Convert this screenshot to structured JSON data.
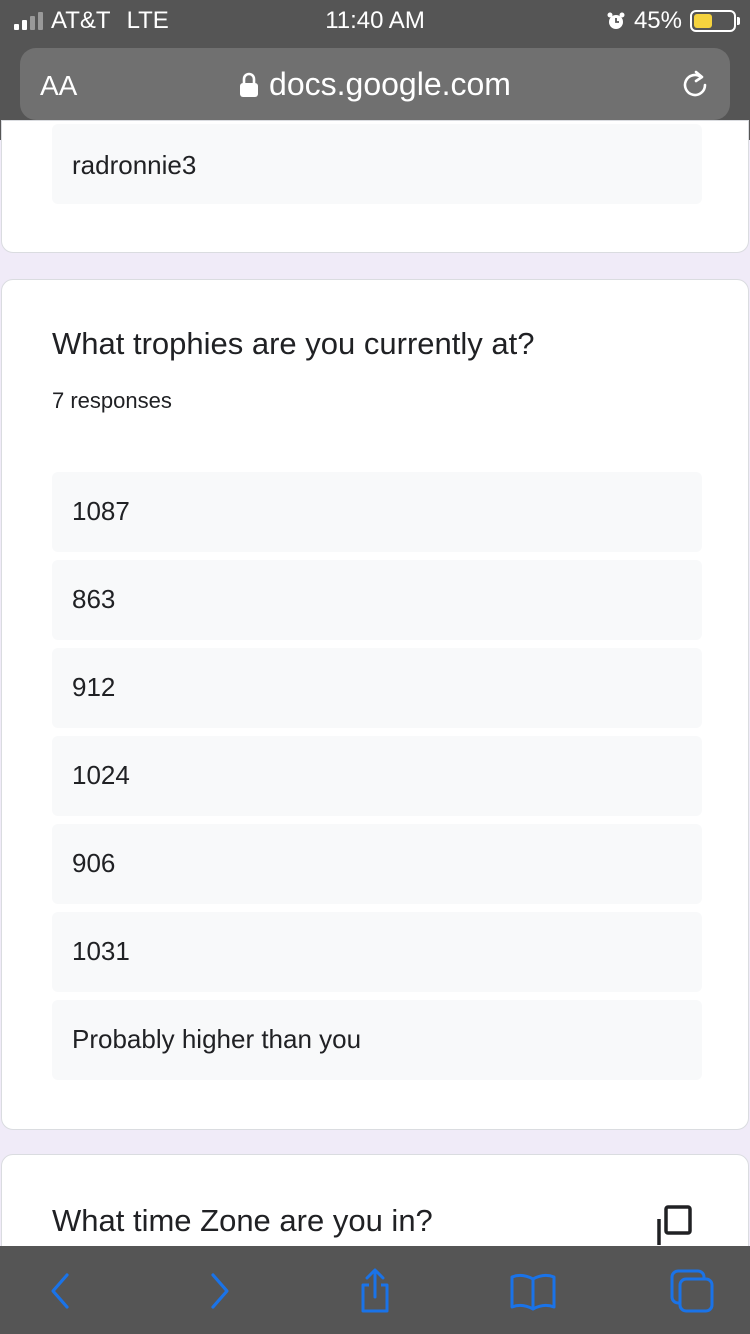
{
  "status_bar": {
    "carrier": "AT&T",
    "network": "LTE",
    "time": "11:40 AM",
    "battery": "45%",
    "battery_level": 0.45,
    "icons": [
      "signal-icon",
      "alarm-icon",
      "battery-icon"
    ]
  },
  "address_bar": {
    "text_size_label": "AA",
    "url": "docs.google.com",
    "icons": [
      "lock-icon",
      "reload-icon"
    ]
  },
  "previous_card": {
    "answer": "radronnie3"
  },
  "question": {
    "title": "What trophies are you currently at?",
    "responses_label": "7 responses",
    "answers": [
      "1087",
      "863",
      "912",
      "1024",
      "906",
      "1031",
      "Probably higher than you"
    ]
  },
  "next_question": {
    "title": "What time Zone are you in?"
  },
  "toolbar": {
    "icons": [
      "back-icon",
      "forward-icon",
      "share-icon",
      "bookmarks-icon",
      "tabs-icon"
    ]
  },
  "colors": {
    "chrome": "#555555",
    "page_background": "#f0ebf8",
    "card": "#ffffff",
    "answer_background": "#f8f9fa",
    "accent_blue": "#1a73e8",
    "battery_yellow": "#f5d33e"
  }
}
